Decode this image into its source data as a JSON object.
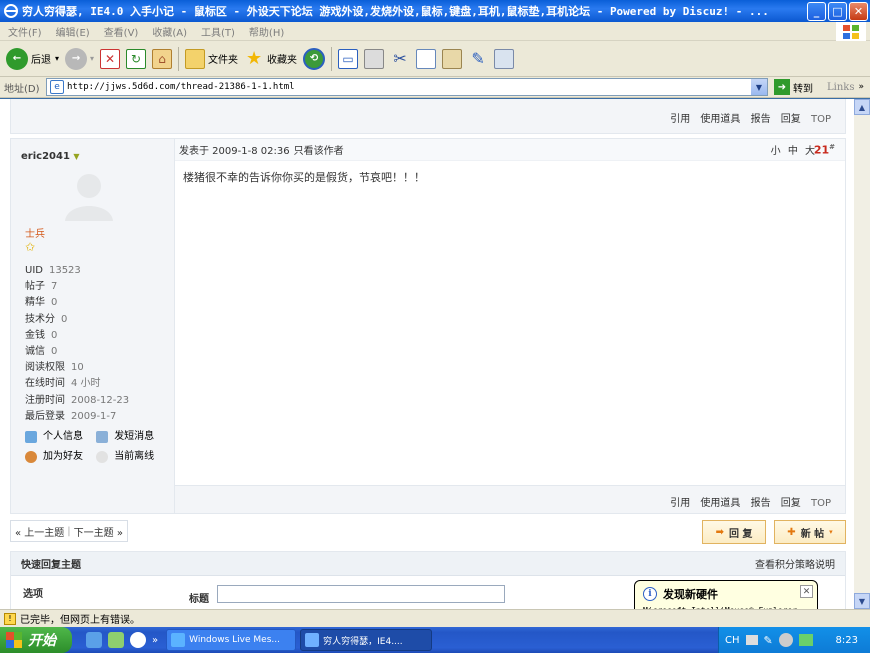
{
  "window": {
    "title": "穷人穷得瑟, IE4.0 入手小记 - 鼠标区 - 外设天下论坛 游戏外设,发烧外设,鼠标,键盘,耳机,鼠标垫,耳机论坛 - Powered by Discuz! - ...",
    "buttons": [
      "_",
      "□",
      "✕"
    ]
  },
  "menubar": {
    "items": [
      "文件(F)",
      "编辑(E)",
      "查看(V)",
      "收藏(A)",
      "工具(T)",
      "帮助(H)"
    ]
  },
  "toolbar": {
    "back_label": "后退",
    "folders_label": "文件夹",
    "favorites_label": "收藏夹"
  },
  "addressbar": {
    "label": "地址(D)",
    "url": "http://jjws.5d6d.com/thread-21386-1-1.html",
    "go_label": "转到",
    "links_label": "Links"
  },
  "thread": {
    "top_actions": [
      "引用",
      "使用道具",
      "报告",
      "回复",
      "TOP"
    ],
    "post": {
      "author": "eric2041",
      "rank": "士兵",
      "stats": [
        {
          "k": "UID",
          "v": "13523"
        },
        {
          "k": "帖子",
          "v": "7"
        },
        {
          "k": "精华",
          "v": "0"
        },
        {
          "k": "技术分",
          "v": "0"
        },
        {
          "k": "金钱",
          "v": "0"
        },
        {
          "k": "诚信",
          "v": "0"
        },
        {
          "k": "阅读权限",
          "v": "10"
        },
        {
          "k": "在线时间",
          "v": "4 小时"
        },
        {
          "k": "注册时间",
          "v": "2008-12-23"
        },
        {
          "k": "最后登录",
          "v": "2009-1-7"
        }
      ],
      "user_links": [
        "个人信息",
        "发短消息",
        "加为好友",
        "当前离线"
      ],
      "posted_at": "发表于  2009-1-8 02:36",
      "only_author": "只看该作者",
      "font_sizes": "小 中 大",
      "floor": "21",
      "floor_mark": "#",
      "message": "楼猪很不幸的告诉你你买的是假货，节哀吧！！！",
      "foot_actions": [
        "引用",
        "使用道具",
        "报告",
        "回复",
        "TOP"
      ]
    },
    "pager": {
      "prev": "« 上一主题",
      "next": "下一主题 »"
    },
    "reply_button": "回 复",
    "new_button": "新 帖",
    "quick_reply": {
      "header": "快速回复主题",
      "help_link": "查看积分策略说明",
      "options_label": "选项",
      "title_label": "标题",
      "title_value": ""
    }
  },
  "balloon": {
    "title": "发现新硬件",
    "text": "Microsoft IntelliMouse® Explorer",
    "close": "✕"
  },
  "statusbar": {
    "text": "已完毕，但网页上有错误。"
  },
  "taskbar": {
    "start_label": "开始",
    "tasks": [
      "Windows Live Mes...",
      "穷人穷得瑟，IE4...."
    ],
    "ime": "CH",
    "clock": "8:23"
  }
}
